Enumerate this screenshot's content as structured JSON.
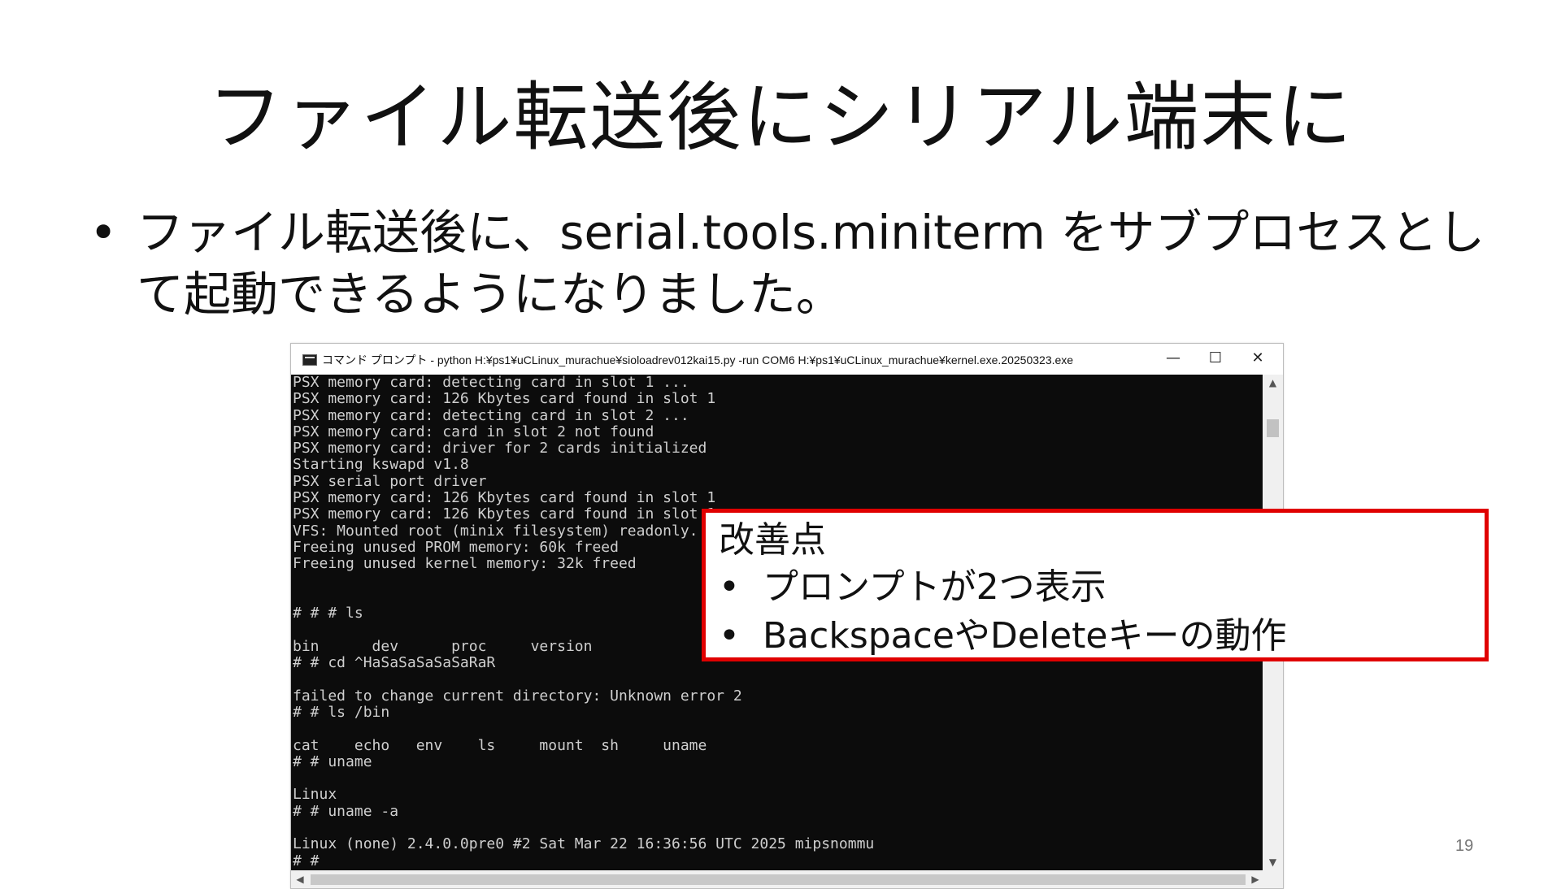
{
  "slide": {
    "title": "ファイル転送後にシリアル端末に",
    "bullet_symbol": "•",
    "bullet_text": "ファイル転送後に、serial.tools.miniterm をサブプロセスとして起動できるようになりました。",
    "page_number": "19"
  },
  "window": {
    "caption": "コマンド プロンプト - python  H:¥ps1¥uCLinux_murachue¥sioloadrev012kai15.py -run COM6 H:¥ps1¥uCLinux_murachue¥kernel.exe.20250323.exe",
    "minimize_glyph": "—",
    "maximize_glyph": "☐",
    "close_glyph": "✕",
    "scroll_up_glyph": "▲",
    "scroll_down_glyph": "▼",
    "scroll_left_glyph": "◀",
    "scroll_right_glyph": "▶",
    "console_lines": [
      "PSX memory card: detecting card in slot 1 ...",
      "PSX memory card: 126 Kbytes card found in slot 1",
      "PSX memory card: detecting card in slot 2 ...",
      "PSX memory card: card in slot 2 not found",
      "PSX memory card: driver for 2 cards initialized",
      "Starting kswapd v1.8",
      "PSX serial port driver",
      "PSX memory card: 126 Kbytes card found in slot 1",
      "PSX memory card: 126 Kbytes card found in slot 1",
      "VFS: Mounted root (minix filesystem) readonly.",
      "Freeing unused PROM memory: 60k freed",
      "Freeing unused kernel memory: 32k freed",
      "",
      "",
      "# # # ls",
      "",
      "bin      dev      proc     version",
      "# # cd ^HaSaSaSaSaSaRaR",
      "",
      "failed to change current directory: Unknown error 2",
      "# # ls /bin",
      "",
      "cat    echo   env    ls     mount  sh     uname",
      "# # uname",
      "",
      "Linux",
      "# # uname -a",
      "",
      "Linux (none) 2.4.0.0pre0 #2 Sat Mar 22 16:36:56 UTC 2025 mipsnommu",
      "# #"
    ]
  },
  "callout": {
    "heading": "改善点",
    "bullet_symbol": "•",
    "items": [
      "プロンプトが2つ表示",
      "BackspaceやDeleteキーの動作"
    ],
    "border_color": "#e00000"
  }
}
